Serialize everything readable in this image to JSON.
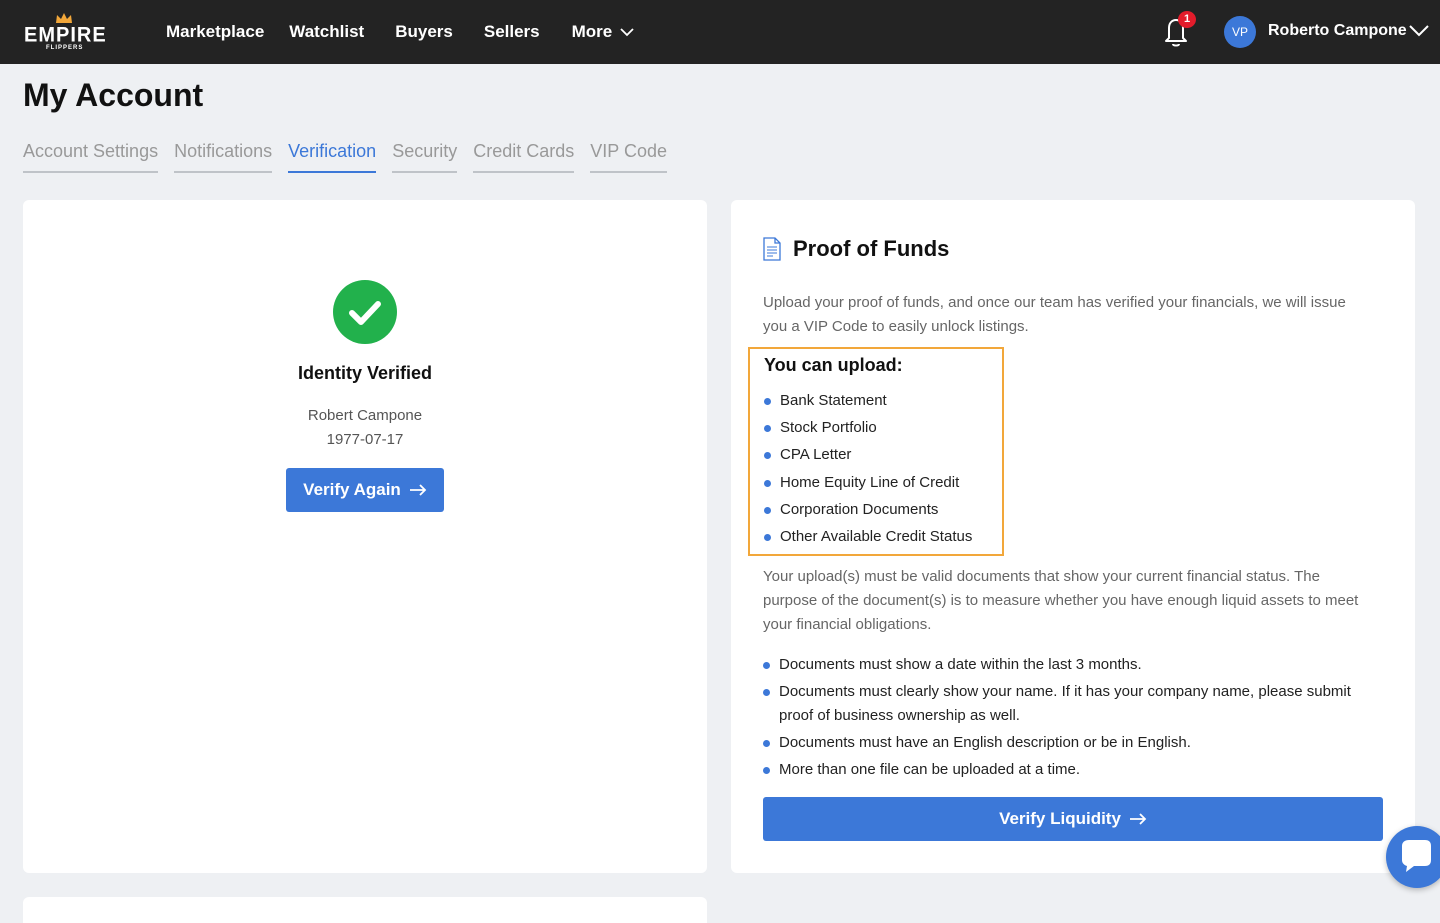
{
  "brand": {
    "name": "EMPIRE",
    "sub": "FLIPPERS"
  },
  "nav": {
    "items": [
      {
        "label": "Marketplace"
      },
      {
        "label": "Watchlist"
      },
      {
        "label": "Buyers"
      },
      {
        "label": "Sellers"
      },
      {
        "label": "More"
      }
    ]
  },
  "header": {
    "notification_count": "1",
    "avatar_initials": "VP",
    "user_name": "Roberto Campone"
  },
  "page": {
    "title": "My Account"
  },
  "tabs": [
    {
      "label": "Account Settings",
      "active": false
    },
    {
      "label": "Notifications",
      "active": false
    },
    {
      "label": "Verification",
      "active": true
    },
    {
      "label": "Security",
      "active": false
    },
    {
      "label": "Credit Cards",
      "active": false
    },
    {
      "label": "VIP Code",
      "active": false
    }
  ],
  "identity": {
    "status": "Identity Verified",
    "name": "Robert Campone",
    "dob": "1977-07-17",
    "button_label": "Verify Again"
  },
  "proof_of_funds": {
    "title": "Proof of Funds",
    "intro": "Upload your proof of funds, and once our team has verified your financials, we will issue you a VIP Code to easily unlock listings.",
    "upload_title": "You can upload:",
    "upload_items": [
      "Bank Statement",
      "Stock Portfolio",
      "CPA Letter",
      "Home Equity Line of Credit",
      "Corporation Documents",
      "Other Available Credit Status"
    ],
    "body": "Your upload(s) must be valid documents that show your current financial status. The purpose of the document(s) is to measure whether you have enough liquid assets to meet your financial obligations.",
    "requirements": [
      "Documents must show a date within the last 3 months.",
      "Documents must clearly show your name. If it has your company name, please submit proof of business ownership as well.",
      "Documents must have an English description or be in English.",
      "More than one file can be uploaded at a time."
    ],
    "button_label": "Verify Liquidity"
  },
  "colors": {
    "accent": "#3c78d8",
    "success": "#22b14c",
    "highlight": "#f2a73a",
    "topbar": "#232323",
    "badge": "#e21c2b"
  }
}
